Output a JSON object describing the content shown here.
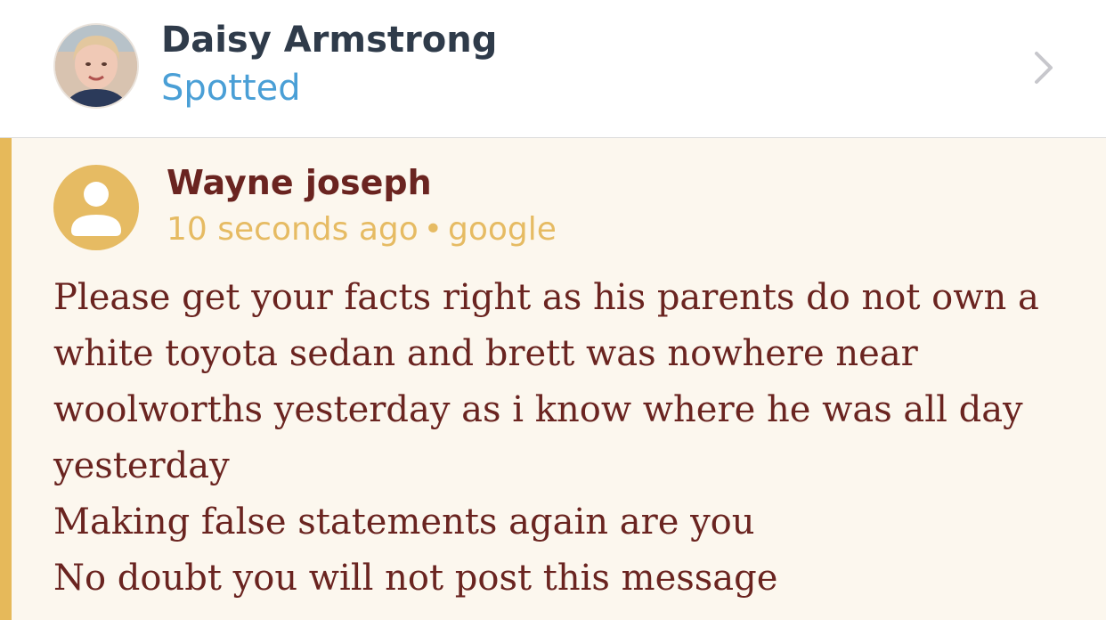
{
  "header": {
    "name": "Daisy Armstrong",
    "subtitle": "Spotted",
    "avatar_icon": "profile-photo",
    "chevron_icon": "chevron-right-icon"
  },
  "comment": {
    "author": "Wayne joseph",
    "time": "10 seconds ago",
    "separator": "•",
    "source": "google",
    "avatar_icon": "user-silhouette-icon",
    "lines": [
      "Please get your facts right as his parents do not own a",
      "white toyota sedan and brett was nowhere near",
      "woolworths yesterday as i know where he was all day",
      "yesterday",
      "Making false statements again are you",
      "No doubt you will not post this message"
    ]
  },
  "colors": {
    "accent": "#e6b95a",
    "author_text": "#6a2420",
    "link_blue": "#4a9fd6",
    "comment_bg": "#fcf7ee"
  }
}
